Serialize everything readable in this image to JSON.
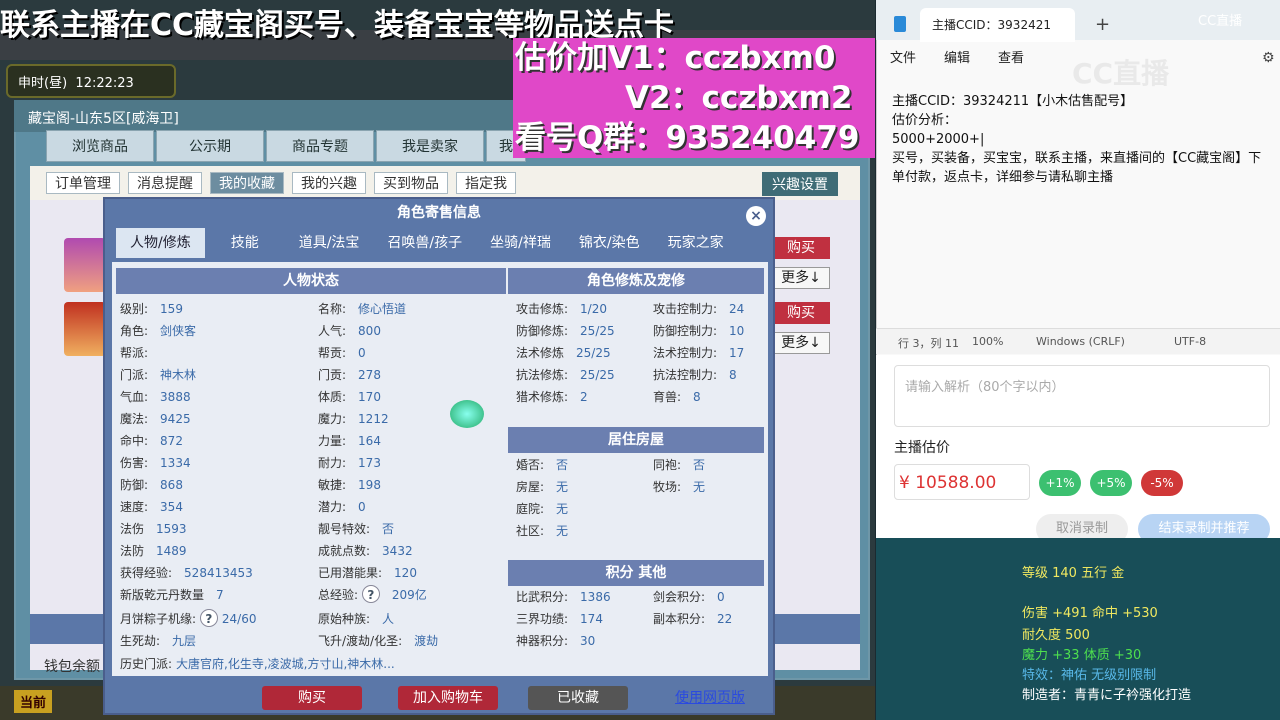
{
  "banner": {
    "line": "联系主播在CC藏宝阁买号、装备宝宝等物品送点卡",
    "est1": "估价加V1：cczbxm0",
    "est2": "V2：cczbxm2",
    "group": "看号Q群：935240479"
  },
  "game": {
    "time": {
      "period": "申时(昼)",
      "clock": "12:22:23"
    },
    "window_title": "藏宝阁-山东5区[威海卫]",
    "tabs": [
      "浏览商品",
      "公示期",
      "商品专题",
      "我是卖家",
      "我"
    ],
    "subnav": [
      "订单管理",
      "消息提醒",
      "我的收藏",
      "我的兴趣",
      "买到物品",
      "指定我"
    ],
    "subnav_selected": "我的收藏",
    "interest_settings": "兴趣设置",
    "list": {
      "buy": "购买",
      "more": "更多↓"
    },
    "wallet": "钱包余额",
    "bottom_left": "当前"
  },
  "modal": {
    "title": "角色寄售信息",
    "close": "×",
    "tabs": [
      "人物/修炼",
      "技能",
      "道具/法宝",
      "召唤兽/孩子",
      "坐骑/祥瑞",
      "锦衣/染色",
      "玩家之家"
    ],
    "selected_tab": "人物/修炼",
    "status_head": "人物状态",
    "col1": [
      [
        "级别:",
        "159"
      ],
      [
        "角色:",
        "剑侠客"
      ],
      [
        "帮派:",
        ""
      ],
      [
        "门派:",
        "神木林"
      ],
      [
        "气血:",
        "3888"
      ],
      [
        "魔法:",
        "9425"
      ],
      [
        "命中:",
        "872"
      ],
      [
        "伤害:",
        "1334"
      ],
      [
        "防御:",
        "868"
      ],
      [
        "速度:",
        "354"
      ],
      [
        "法伤",
        "1593"
      ],
      [
        "法防",
        "1489"
      ],
      [
        "获得经验:",
        "528413453"
      ],
      [
        "新版乾元丹数量",
        "7"
      ]
    ],
    "col2": [
      [
        "名称:",
        "修心悟道"
      ],
      [
        "人气:",
        "800"
      ],
      [
        "帮贡:",
        "0"
      ],
      [
        "门贡:",
        "278"
      ],
      [
        "体质:",
        "170"
      ],
      [
        "魔力:",
        "1212"
      ],
      [
        "力量:",
        "164"
      ],
      [
        "耐力:",
        "173"
      ],
      [
        "敏捷:",
        "198"
      ],
      [
        "潜力:",
        "0"
      ],
      [
        "靓号特效:",
        "否"
      ],
      [
        "成就点数:",
        "3432"
      ],
      [
        "已用潜能果:",
        "120"
      ]
    ],
    "total_exp": {
      "label": "总经验:",
      "value": "209亿"
    },
    "mooncake": {
      "label": "月饼粽子机缘:",
      "value": "24/60"
    },
    "race": {
      "label": "原始种族:",
      "value": "人"
    },
    "life": {
      "label": "生死劫:",
      "value": "九层"
    },
    "fly": {
      "label": "飞升/渡劫/化圣:",
      "value": "渡劫"
    },
    "history": {
      "label": "历史门派:",
      "value": "大唐官府,化生寺,凌波城,方寸山,神木林..."
    },
    "cult_head": "角色修炼及宠修",
    "cult_l": [
      [
        "攻击修炼:",
        "1/20"
      ],
      [
        "防御修炼:",
        "25/25"
      ],
      [
        "法术修炼",
        "25/25"
      ],
      [
        "抗法修炼:",
        "25/25"
      ],
      [
        "猎术修炼:",
        "2"
      ]
    ],
    "cult_r": [
      [
        "攻击控制力:",
        "24"
      ],
      [
        "防御控制力:",
        "10"
      ],
      [
        "法术控制力:",
        "17"
      ],
      [
        "抗法控制力:",
        "8"
      ],
      [
        "育兽:",
        "8"
      ]
    ],
    "house_head": "居住房屋",
    "house_l": [
      [
        "婚否:",
        "否"
      ],
      [
        "房屋:",
        "无"
      ],
      [
        "庭院:",
        "无"
      ],
      [
        "社区:",
        "无"
      ]
    ],
    "house_r": [
      [
        "同袍:",
        "否"
      ],
      [
        "牧场:",
        "无"
      ]
    ],
    "score_head": "积分 其他",
    "score_l": [
      [
        "比武积分:",
        "1386"
      ],
      [
        "三界功绩:",
        "174"
      ],
      [
        "神器积分:",
        "30"
      ]
    ],
    "score_r": [
      [
        "剑会积分:",
        "0"
      ],
      [
        "副本积分:",
        "22"
      ]
    ],
    "buttons": {
      "buy": "购买",
      "cart": "加入购物车",
      "fav": "已收藏",
      "web": "使用网页版"
    }
  },
  "notepad": {
    "tab": "主播CCID：3932421",
    "menu": [
      "文件",
      "编辑",
      "查看"
    ],
    "lines": [
      "主播CCID：39324211【小木估售配号】",
      "估价分析：",
      "5000+2000+|",
      "买号，买装备，买宝宝，联系主播，来直播间的【CC藏宝阁】下单付款，返点卡，详细参与请私聊主播"
    ],
    "status": [
      "行 3，列 11",
      "100%",
      "Windows (CRLF)",
      "UTF-8"
    ]
  },
  "web": {
    "placeholder": "请输入解析（80个字以内）",
    "price_label": "主播估价",
    "price": "¥ 10588.00",
    "pills": [
      "+1%",
      "+5%",
      "-5%"
    ],
    "cancel": "取消录制",
    "finish": "结束录制并推荐"
  },
  "tooltip": {
    "level": "等级 140 五行 金",
    "dmg": "伤害 +491 命中 +530",
    "dur": "耐久度 500",
    "magic": "魔力 +33 体质 +30",
    "effect": "特效：神佑 无级别限制",
    "maker": "制造者：青青に子衿强化打造"
  },
  "cc": {
    "logo": "CC直播",
    "corner": "CC直播"
  },
  "colors": {
    "pink": "#e048c8",
    "teal": "#184e58",
    "modal": "#5b77a8",
    "buy": "#c03040"
  }
}
